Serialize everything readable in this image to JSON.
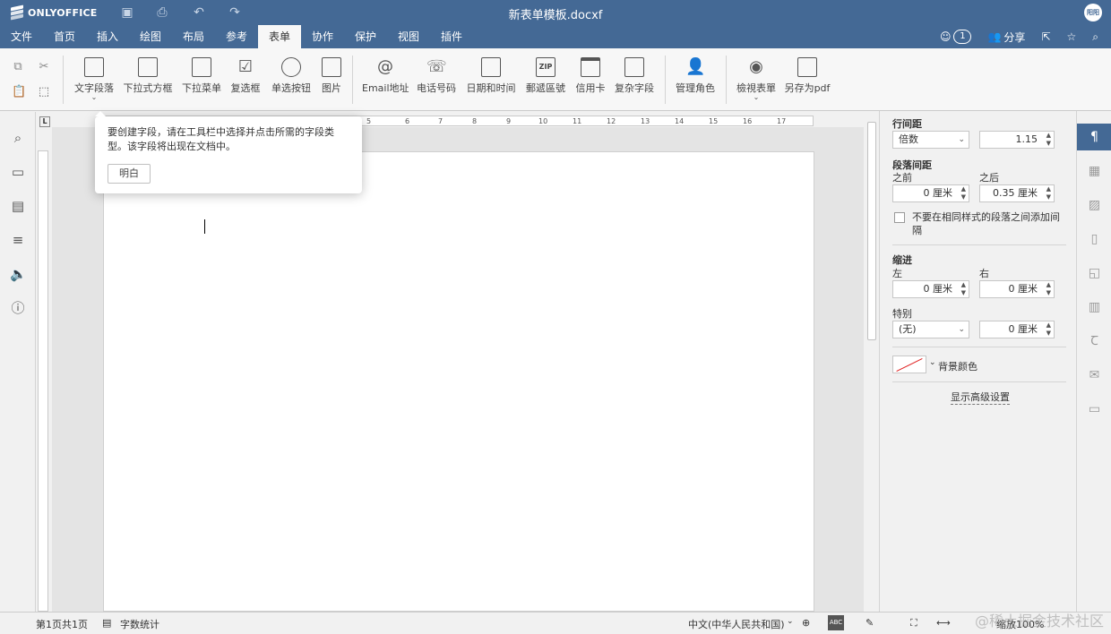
{
  "app": {
    "logo_text": "ONLYOFFICE",
    "doc_title": "新表单模板.docxf",
    "avatar_text": "阳阳"
  },
  "menu": {
    "tabs": [
      {
        "label": "文件"
      },
      {
        "label": "首页"
      },
      {
        "label": "插入"
      },
      {
        "label": "绘图"
      },
      {
        "label": "布局"
      },
      {
        "label": "参考"
      },
      {
        "label": "表单"
      },
      {
        "label": "协作"
      },
      {
        "label": "保护"
      },
      {
        "label": "视图"
      },
      {
        "label": "插件"
      }
    ],
    "active_tab": "表单",
    "users_count": "1",
    "share_label": "分享"
  },
  "toolbar": {
    "buttons": [
      {
        "label": "文字段落",
        "icon": "text-field-icon"
      },
      {
        "label": "下拉式方框",
        "icon": "combo-box-icon"
      },
      {
        "label": "下拉菜单",
        "icon": "dropdown-icon"
      },
      {
        "label": "复选框",
        "icon": "checkbox-icon"
      },
      {
        "label": "单选按钮",
        "icon": "radio-icon"
      },
      {
        "label": "图片",
        "icon": "image-icon"
      },
      {
        "label": "Email地址",
        "icon": "at-icon"
      },
      {
        "label": "电话号码",
        "icon": "phone-icon"
      },
      {
        "label": "日期和时间",
        "icon": "calendar-icon"
      },
      {
        "label": "郵遞區號",
        "icon": "zip-icon"
      },
      {
        "label": "信用卡",
        "icon": "card-icon"
      },
      {
        "label": "复杂字段",
        "icon": "complex-field-icon"
      },
      {
        "label": "管理角色",
        "icon": "roles-icon"
      },
      {
        "label": "檢視表單",
        "icon": "eye-icon"
      },
      {
        "label": "另存为pdf",
        "icon": "save-pdf-icon"
      }
    ],
    "zip_glyph": "ZIP"
  },
  "tooltip": {
    "text": "要创建字段，请在工具栏中选择并点击所需的字段类型。该字段将出现在文档中。",
    "button": "明白"
  },
  "ruler": {
    "numbers": [
      "5",
      "6",
      "7",
      "8",
      "9",
      "10",
      "11",
      "12",
      "13",
      "14",
      "15",
      "16",
      "17"
    ]
  },
  "panel": {
    "line_spacing_label": "行间距",
    "line_spacing_mode": "倍数",
    "line_spacing_value": "1.15",
    "para_spacing_label": "段落间距",
    "before_label": "之前",
    "after_label": "之后",
    "before_value": "0 厘米",
    "after_value": "0.35 厘米",
    "no_space_label": "不要在相同样式的段落之间添加间隔",
    "indent_label": "缩进",
    "left_label": "左",
    "right_label": "右",
    "left_value": "0 厘米",
    "right_value": "0 厘米",
    "special_label": "特别",
    "special_mode": "(无)",
    "special_value": "0 厘米",
    "bg_color_label": "背景颜色",
    "advanced_label": "显示高级设置"
  },
  "status": {
    "page_info": "第1页共1页",
    "word_count": "字数统计",
    "language": "中文(中华人民共和国)",
    "zoom": "缩放100%",
    "watermark": "@稀土掘金技术社区"
  }
}
